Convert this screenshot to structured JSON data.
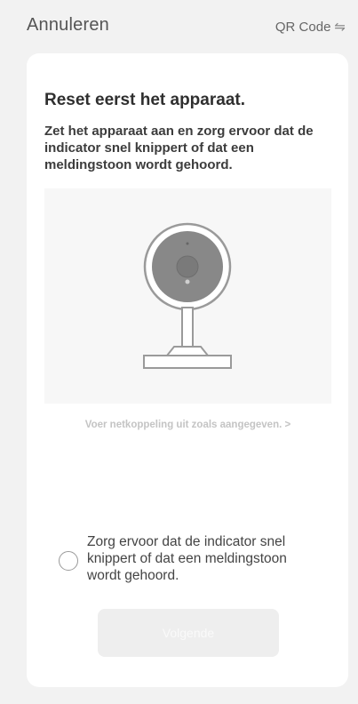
{
  "header": {
    "cancel_label": "Annuleren",
    "qr_label": "QR Code",
    "qr_icon": "swap-arrows-icon"
  },
  "card": {
    "title": "Reset eerst het apparaat.",
    "description": "Zet het apparaat aan en zorg ervoor dat de indicator snel knippert of dat een meldingstoon wordt gehoord.",
    "illustration_icon": "camera-illustration",
    "hint_link": "Voer netkoppeling uit zoals aangegeven.",
    "hint_chevron": ">",
    "confirm_text": "Zorg ervoor dat de indicator snel knippert of dat een meldingstoon wordt gehoord.",
    "confirm_checked": false,
    "next_label": "Volgende",
    "next_enabled": false
  }
}
